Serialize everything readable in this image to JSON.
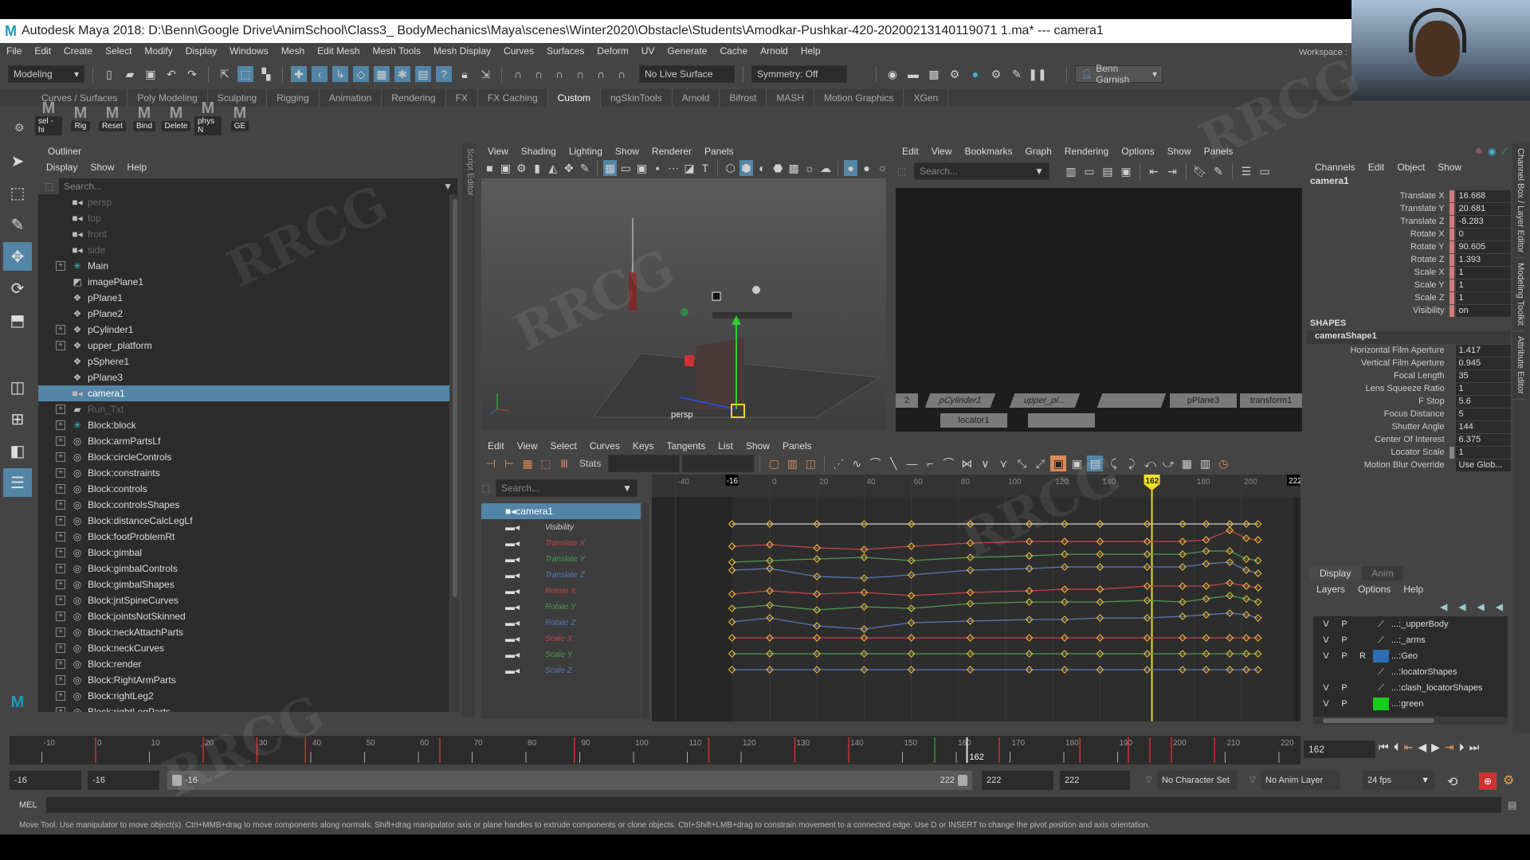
{
  "window": {
    "title": "Autodesk Maya 2018: D:\\Benn\\Google Drive\\AnimSchool\\Class3_ BodyMechanics\\Maya\\scenes\\Winter2020\\Obstacle\\Students\\Amodkar-Pushkar-420-20200213140119071 1.ma*   ---   camera1",
    "logo": "M"
  },
  "menubar": [
    "File",
    "Edit",
    "Create",
    "Select",
    "Modify",
    "Display",
    "Windows",
    "Mesh",
    "Edit Mesh",
    "Mesh Tools",
    "Mesh Display",
    "Curves",
    "Surfaces",
    "Deform",
    "UV",
    "Generate",
    "Cache",
    "Arnold",
    "Help"
  ],
  "workspace_label": "Workspace :",
  "statusline": {
    "menuset": "Modeling",
    "live_surface": "No Live Surface",
    "symmetry": "Symmetry: Off",
    "user": "Benn Garnish"
  },
  "shelf_tabs": [
    "Curves / Surfaces",
    "Poly Modeling",
    "Sculpting",
    "Rigging",
    "Animation",
    "Rendering",
    "FX",
    "FX Caching",
    "Custom",
    "ngSkinTools",
    "Arnold",
    "Bifrost",
    "MASH",
    "Motion Graphics",
    "XGen"
  ],
  "shelf_active": "Custom",
  "shelf_buttons": [
    "sel -hi",
    "Rig",
    "Reset",
    "Bind",
    "Delete",
    "phys N",
    "GE"
  ],
  "outliner": {
    "title": "Outliner",
    "menus": [
      "Display",
      "Show",
      "Help"
    ],
    "search_placeholder": "Search...",
    "items": [
      {
        "label": "persp",
        "icon": "camera",
        "expand": false,
        "dim": true
      },
      {
        "label": "top",
        "icon": "camera",
        "expand": false,
        "dim": true
      },
      {
        "label": "front",
        "icon": "camera",
        "expand": false,
        "dim": true
      },
      {
        "label": "side",
        "icon": "camera",
        "expand": false,
        "dim": true
      },
      {
        "label": "Main",
        "icon": "joint",
        "expand": true
      },
      {
        "label": "imagePlane1",
        "icon": "imageplane",
        "expand": false
      },
      {
        "label": "pPlane1",
        "icon": "mesh",
        "expand": false
      },
      {
        "label": "pPlane2",
        "icon": "mesh",
        "expand": false
      },
      {
        "label": "pCylinder1",
        "icon": "mesh",
        "expand": true
      },
      {
        "label": "upper_platform",
        "icon": "mesh",
        "expand": true
      },
      {
        "label": "pSphere1",
        "icon": "mesh",
        "expand": false
      },
      {
        "label": "pPlane3",
        "icon": "mesh",
        "expand": false
      },
      {
        "label": "camera1",
        "icon": "camera",
        "expand": false,
        "selected": true
      },
      {
        "label": "Run_Txt",
        "icon": "text",
        "expand": true,
        "dim": true
      },
      {
        "label": "Block:block",
        "icon": "joint",
        "expand": true
      },
      {
        "label": "Block:armPartsLf",
        "icon": "reference",
        "expand": true
      },
      {
        "label": "Block:circleControls",
        "icon": "reference",
        "expand": true
      },
      {
        "label": "Block:constraints",
        "icon": "reference",
        "expand": true
      },
      {
        "label": "Block:controls",
        "icon": "reference",
        "expand": true
      },
      {
        "label": "Block:controlsShapes",
        "icon": "reference",
        "expand": true
      },
      {
        "label": "Block:distanceCalcLegLf",
        "icon": "reference",
        "expand": true
      },
      {
        "label": "Block:footProblemRt",
        "icon": "reference",
        "expand": true
      },
      {
        "label": "Block:gimbal",
        "icon": "reference",
        "expand": true
      },
      {
        "label": "Block:gimbalControls",
        "icon": "reference",
        "expand": true
      },
      {
        "label": "Block:gimbalShapes",
        "icon": "reference",
        "expand": true
      },
      {
        "label": "Block:jntSpineCurves",
        "icon": "reference",
        "expand": true
      },
      {
        "label": "Block:jointsNotSkinned",
        "icon": "reference",
        "expand": true
      },
      {
        "label": "Block:neckAttachParts",
        "icon": "reference",
        "expand": true
      },
      {
        "label": "Block:neckCurves",
        "icon": "reference",
        "expand": true
      },
      {
        "label": "Block:render",
        "icon": "reference",
        "expand": true
      },
      {
        "label": "Block:RightArmParts",
        "icon": "reference",
        "expand": true
      },
      {
        "label": "Block:rightLeg2",
        "icon": "reference",
        "expand": true
      },
      {
        "label": "Block:rightLegParts",
        "icon": "reference",
        "expand": true
      }
    ]
  },
  "script_editor_tab": "Script Editor",
  "viewport": {
    "menus": [
      "View",
      "Shading",
      "Lighting",
      "Show",
      "Renderer",
      "Panels"
    ],
    "camera_label": "persp"
  },
  "node_editor": {
    "menus": [
      "Edit",
      "View",
      "Bookmarks",
      "Graph",
      "Rendering",
      "Options",
      "Show",
      "Panels"
    ],
    "search_placeholder": "Search...",
    "nodes": [
      "2",
      "pCylinder1",
      "upper_pl...",
      "",
      "pPlane3",
      "transform1",
      "locator1",
      ""
    ]
  },
  "graph_editor": {
    "menus": [
      "Edit",
      "View",
      "Select",
      "Curves",
      "Keys",
      "Tangents",
      "List",
      "Show",
      "Panels"
    ],
    "stats_label": "Stats",
    "search_placeholder": "Search...",
    "object": "camera1",
    "channels": [
      {
        "label": "Visibility",
        "color": "#cfcfcf"
      },
      {
        "label": "Translate X",
        "color": "#c0464b"
      },
      {
        "label": "Translate Y",
        "color": "#4c9a52"
      },
      {
        "label": "Translate Z",
        "color": "#5a78b8"
      },
      {
        "label": "Rotate X",
        "color": "#c0464b"
      },
      {
        "label": "Rotate Y",
        "color": "#4c9a52"
      },
      {
        "label": "Rotate Z",
        "color": "#5a78b8"
      },
      {
        "label": "Scale X",
        "color": "#c0464b"
      },
      {
        "label": "Scale Y",
        "color": "#4c9a52"
      },
      {
        "label": "Scale Z",
        "color": "#5a78b8"
      }
    ],
    "ruler_ticks": [
      "-40",
      "-16",
      "0",
      "20",
      "40",
      "60",
      "80",
      "100",
      "120",
      "140",
      "162",
      "180",
      "200",
      "222"
    ],
    "range_start": "-16",
    "current_frame": "162",
    "range_end": "222",
    "key_frames": [
      -16,
      0,
      20,
      40,
      60,
      85,
      110,
      125,
      140,
      160,
      175,
      185,
      195,
      202,
      207
    ]
  },
  "channel_box": {
    "menus": [
      "Channels",
      "Edit",
      "Object",
      "Show"
    ],
    "object": "camera1",
    "attributes": [
      {
        "label": "Translate X",
        "value": "16.668"
      },
      {
        "label": "Translate Y",
        "value": "20.681"
      },
      {
        "label": "Translate Z",
        "value": "-8.283"
      },
      {
        "label": "Rotate X",
        "value": "0"
      },
      {
        "label": "Rotate Y",
        "value": "90.605"
      },
      {
        "label": "Rotate Z",
        "value": "1.393"
      },
      {
        "label": "Scale X",
        "value": "1"
      },
      {
        "label": "Scale Y",
        "value": "1"
      },
      {
        "label": "Scale Z",
        "value": "1"
      },
      {
        "label": "Visibility",
        "value": "on"
      }
    ],
    "shapes_header": "SHAPES",
    "shape_name": "cameraShape1",
    "shape_attributes": [
      {
        "label": "Horizontal Film Aperture",
        "value": "1.417"
      },
      {
        "label": "Vertical Film Aperture",
        "value": "0.945"
      },
      {
        "label": "Focal Length",
        "value": "35"
      },
      {
        "label": "Lens Squeeze Ratio",
        "value": "1"
      },
      {
        "label": "F Stop",
        "value": "5.6"
      },
      {
        "label": "Focus Distance",
        "value": "5"
      },
      {
        "label": "Shutter Angle",
        "value": "144"
      },
      {
        "label": "Center Of Interest",
        "value": "6.375"
      },
      {
        "label": "Locator Scale",
        "value": "1"
      },
      {
        "label": "Motion Blur Override",
        "value": "Use Glob..."
      }
    ]
  },
  "side_tabs": [
    "Channel Box / Layer Editor",
    "Modeling Toolkit",
    "Attribute Editor"
  ],
  "layer_editor": {
    "tabs": [
      "Display",
      "Anim"
    ],
    "active_tab": "Display",
    "menus": [
      "Layers",
      "Options",
      "Help"
    ],
    "layers": [
      {
        "v": "V",
        "p": "P",
        "r": "",
        "name": "...:_upperBody",
        "color": ""
      },
      {
        "v": "V",
        "p": "P",
        "r": "",
        "name": "...:_arms",
        "color": ""
      },
      {
        "v": "V",
        "p": "P",
        "r": "R",
        "name": "...:Geo",
        "color": "#2d6db5"
      },
      {
        "v": "",
        "p": "",
        "r": "",
        "name": "...:locatorShapes",
        "color": ""
      },
      {
        "v": "V",
        "p": "P",
        "r": "",
        "name": "...:clash_locatorShapes",
        "color": ""
      },
      {
        "v": "V",
        "p": "P",
        "r": "",
        "name": "...:green",
        "color": "#19cc19"
      }
    ]
  },
  "time_slider": {
    "ticks": [
      "-10",
      "0",
      "10",
      "20",
      "30",
      "40",
      "50",
      "60",
      "70",
      "80",
      "90",
      "100",
      "110",
      "120",
      "130",
      "140",
      "150",
      "160",
      "170",
      "180",
      "190",
      "200",
      "210",
      "220"
    ],
    "current_frame": "162",
    "current_frame_field": "162",
    "key_frames": [
      0,
      20,
      30,
      39,
      64,
      89,
      114,
      130,
      140,
      168,
      183,
      192,
      196,
      200,
      208
    ],
    "min": -16,
    "max": 224
  },
  "range_slider": {
    "start_field": "-16",
    "anim_start": "-16",
    "bar_start": "-16",
    "bar_end": "222",
    "anim_end": "222",
    "end_field": "222",
    "character_set": "No Character Set",
    "anim_layer": "No Anim Layer",
    "fps": "24 fps"
  },
  "command_line": {
    "label": "MEL"
  },
  "help_line": "Move Tool: Use manipulator to move object(s). Ctrl+MMB+drag to move components along normals. Shift+drag manipulator axis or plane handles to extrude components or clone objects. Ctrl+Shift+LMB+drag to constrain movement to a connected edge. Use D or INSERT to change the pivot position and axis orientation."
}
